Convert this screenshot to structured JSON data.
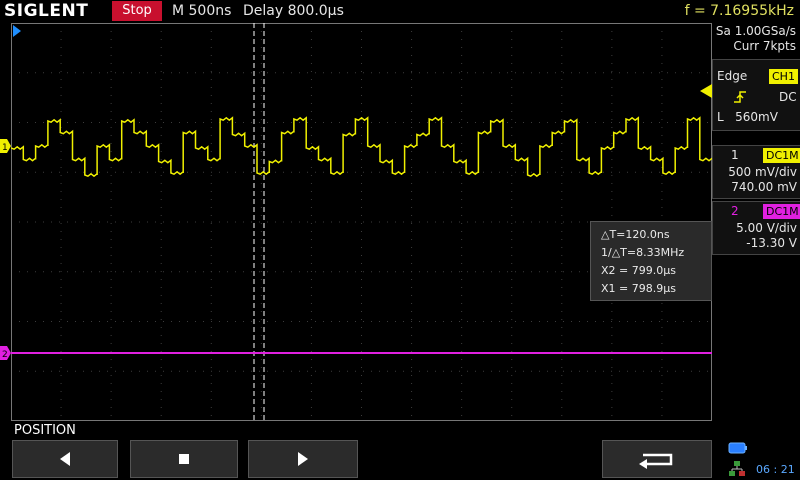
{
  "header": {
    "brand": "SIGLENT",
    "run_state": "Stop",
    "timebase": "M 500ns",
    "delay": "Delay 800.0μs",
    "frequency": "f = 7.16955kHz"
  },
  "acquisition": {
    "sample_rate": "Sa 1.00GSa/s",
    "memory": "Curr 7kpts"
  },
  "trigger": {
    "type": "Edge",
    "source": "CH1",
    "coupling": "DC",
    "level": "L   560mV"
  },
  "channels": [
    {
      "number": "1",
      "coupling": "DC1M",
      "scale": "500 mV/div",
      "offset": "740.00 mV",
      "color": "#f0f000"
    },
    {
      "number": "2",
      "coupling": "DC1M",
      "scale": "5.00 V/div",
      "offset": "-13.30 V",
      "color": "#e020e0"
    }
  ],
  "cursor_readout": {
    "delta_t": "△T=120.0ns",
    "inv_delta_t": "1/△T=8.33MHz",
    "x2": "X2 = 799.0μs",
    "x1": "X1 = 798.9μs"
  },
  "softkeys": {
    "menu_label": "POSITION"
  },
  "status": {
    "clock": "06 : 21"
  },
  "colors": {
    "ch1": "#f0f000",
    "ch2": "#e020e0",
    "grid": "#3c3c3c",
    "stop": "#c8102e"
  }
}
